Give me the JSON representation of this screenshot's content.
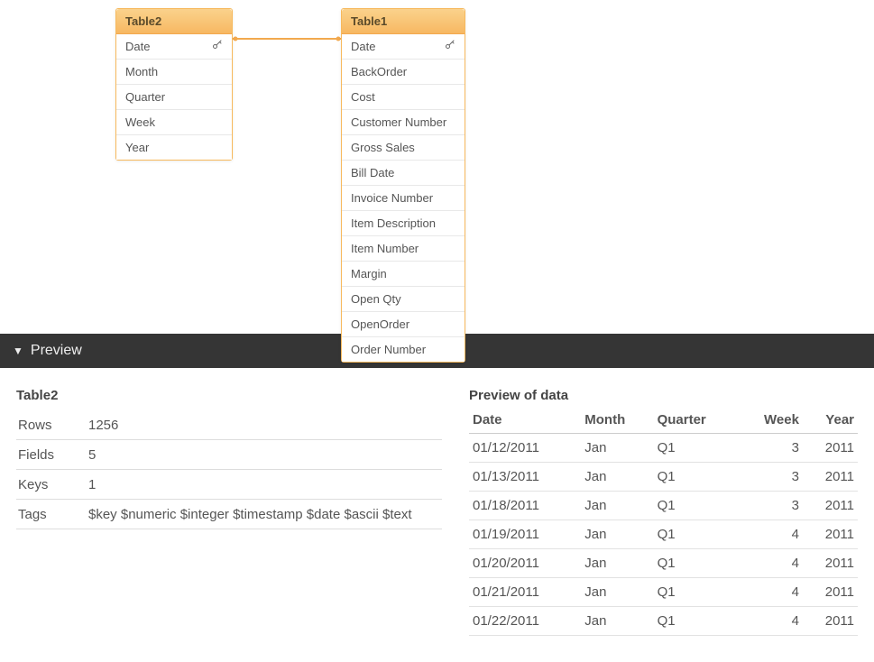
{
  "canvas": {
    "table2": {
      "title": "Table2",
      "fields": [
        {
          "label": "Date",
          "key": true
        },
        {
          "label": "Month",
          "key": false
        },
        {
          "label": "Quarter",
          "key": false
        },
        {
          "label": "Week",
          "key": false
        },
        {
          "label": "Year",
          "key": false
        }
      ]
    },
    "table1": {
      "title": "Table1",
      "fields": [
        {
          "label": "Date",
          "key": true
        },
        {
          "label": "BackOrder",
          "key": false
        },
        {
          "label": "Cost",
          "key": false
        },
        {
          "label": "Customer Number",
          "key": false
        },
        {
          "label": "Gross Sales",
          "key": false
        },
        {
          "label": "Bill Date",
          "key": false
        },
        {
          "label": "Invoice Number",
          "key": false
        },
        {
          "label": "Item Description",
          "key": false
        },
        {
          "label": "Item Number",
          "key": false
        },
        {
          "label": "Margin",
          "key": false
        },
        {
          "label": "Open Qty",
          "key": false
        },
        {
          "label": "OpenOrder",
          "key": false
        },
        {
          "label": "Order Number",
          "key": false
        }
      ]
    }
  },
  "preview": {
    "header": "Preview",
    "meta_title": "Table2",
    "meta": [
      {
        "k": "Rows",
        "v": "1256"
      },
      {
        "k": "Fields",
        "v": "5"
      },
      {
        "k": "Keys",
        "v": "1"
      },
      {
        "k": "Tags",
        "v": "$key $numeric $integer $timestamp $date $ascii $text"
      }
    ],
    "data_title": "Preview of data",
    "columns": [
      "Date",
      "Month",
      "Quarter",
      "Week",
      "Year"
    ],
    "rows": [
      [
        "01/12/2011",
        "Jan",
        "Q1",
        "3",
        "2011"
      ],
      [
        "01/13/2011",
        "Jan",
        "Q1",
        "3",
        "2011"
      ],
      [
        "01/18/2011",
        "Jan",
        "Q1",
        "3",
        "2011"
      ],
      [
        "01/19/2011",
        "Jan",
        "Q1",
        "4",
        "2011"
      ],
      [
        "01/20/2011",
        "Jan",
        "Q1",
        "4",
        "2011"
      ],
      [
        "01/21/2011",
        "Jan",
        "Q1",
        "4",
        "2011"
      ],
      [
        "01/22/2011",
        "Jan",
        "Q1",
        "4",
        "2011"
      ]
    ]
  }
}
